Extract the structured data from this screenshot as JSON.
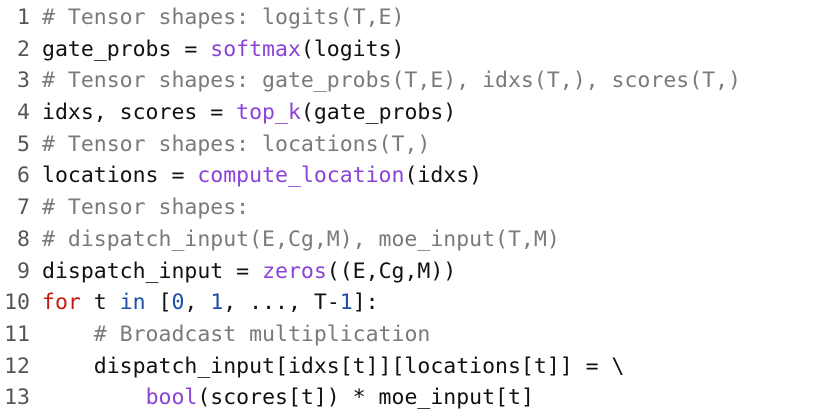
{
  "colors": {
    "comment": "#7a7a7a",
    "function": "#8a43d6",
    "keyword": "#c01c12",
    "number": "#1b4fa6",
    "text": "#111111",
    "line_number": "#555555"
  },
  "lines": [
    {
      "number": "1",
      "tokens": [
        {
          "type": "comment",
          "text": "# Tensor shapes: logits(T,E)"
        }
      ]
    },
    {
      "number": "2",
      "tokens": [
        {
          "type": "plain",
          "text": "gate_probs = "
        },
        {
          "type": "func",
          "text": "softmax"
        },
        {
          "type": "plain",
          "text": "(logits)"
        }
      ]
    },
    {
      "number": "3",
      "tokens": [
        {
          "type": "comment",
          "text": "# Tensor shapes: gate_probs(T,E), idxs(T,), scores(T,)"
        }
      ]
    },
    {
      "number": "4",
      "tokens": [
        {
          "type": "plain",
          "text": "idxs, scores = "
        },
        {
          "type": "func",
          "text": "top_k"
        },
        {
          "type": "plain",
          "text": "(gate_probs)"
        }
      ]
    },
    {
      "number": "5",
      "tokens": [
        {
          "type": "comment",
          "text": "# Tensor shapes: locations(T,)"
        }
      ]
    },
    {
      "number": "6",
      "tokens": [
        {
          "type": "plain",
          "text": "locations = "
        },
        {
          "type": "func",
          "text": "compute_location"
        },
        {
          "type": "plain",
          "text": "(idxs)"
        }
      ]
    },
    {
      "number": "7",
      "tokens": [
        {
          "type": "comment",
          "text": "# Tensor shapes:"
        }
      ]
    },
    {
      "number": "8",
      "tokens": [
        {
          "type": "comment",
          "text": "# dispatch_input(E,Cg,M), moe_input(T,M)"
        }
      ]
    },
    {
      "number": "9",
      "tokens": [
        {
          "type": "plain",
          "text": "dispatch_input = "
        },
        {
          "type": "func",
          "text": "zeros"
        },
        {
          "type": "plain",
          "text": "((E,Cg,M))"
        }
      ]
    },
    {
      "number": "10",
      "tokens": [
        {
          "type": "keyword",
          "text": "for"
        },
        {
          "type": "plain",
          "text": " t "
        },
        {
          "type": "number",
          "text": "in"
        },
        {
          "type": "plain",
          "text": " ["
        },
        {
          "type": "number",
          "text": "0"
        },
        {
          "type": "plain",
          "text": ", "
        },
        {
          "type": "number",
          "text": "1"
        },
        {
          "type": "plain",
          "text": ", ..., T-"
        },
        {
          "type": "number",
          "text": "1"
        },
        {
          "type": "plain",
          "text": "]:"
        }
      ]
    },
    {
      "number": "11",
      "tokens": [
        {
          "type": "plain",
          "text": "    "
        },
        {
          "type": "comment",
          "text": "# Broadcast multiplication"
        }
      ]
    },
    {
      "number": "12",
      "tokens": [
        {
          "type": "plain",
          "text": "    dispatch_input[idxs[t]][locations[t]] = \\"
        }
      ]
    },
    {
      "number": "13",
      "tokens": [
        {
          "type": "plain",
          "text": "        "
        },
        {
          "type": "func",
          "text": "bool"
        },
        {
          "type": "plain",
          "text": "(scores[t]) * moe_input[t]"
        }
      ]
    }
  ]
}
